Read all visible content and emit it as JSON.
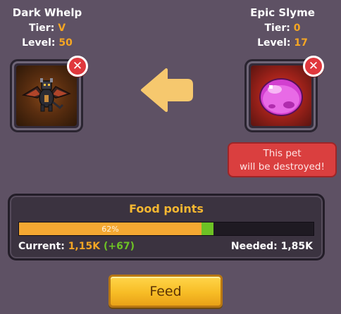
{
  "left_pet": {
    "name": "Dark Whelp",
    "tier_label": "Tier:",
    "tier_value": "V",
    "level_label": "Level:",
    "level_value": "50",
    "icon": "dark-whelp-icon"
  },
  "right_pet": {
    "name": "Epic Slyme",
    "tier_label": "Tier:",
    "tier_value": "0",
    "level_label": "Level:",
    "level_value": "17",
    "icon": "epic-slyme-icon"
  },
  "destroy_warning": {
    "line1": "This pet",
    "line2": "will be destroyed!"
  },
  "food": {
    "title": "Food points",
    "progress_fraction": 0.62,
    "gain_fraction": 0.04,
    "percent_label": "62%",
    "current_label": "Current:",
    "current_value": "1,15K",
    "current_gain": "(+67)",
    "needed_label": "Needed:",
    "needed_value": "1,85K"
  },
  "feed_button": {
    "label": "Feed"
  },
  "colors": {
    "background": "#5e5164",
    "accent_orange": "#f5a623",
    "gain_green": "#6dc225",
    "danger_red": "#da3f3f",
    "button_gold": "#f7bd26"
  }
}
